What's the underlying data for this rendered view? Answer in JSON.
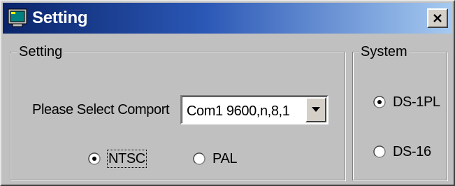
{
  "window": {
    "title": "Setting",
    "icon": "monitor-icon",
    "close_icon": "close-icon"
  },
  "setting_group": {
    "legend": "Setting",
    "comport_label": "Please Select Comport",
    "comport_value": "Com1 9600,n,8,1",
    "dropdown_icon": "chevron-down-icon",
    "video_options": [
      {
        "label": "NTSC",
        "selected": true
      },
      {
        "label": "PAL",
        "selected": false
      }
    ]
  },
  "system_group": {
    "legend": "System",
    "options": [
      {
        "label": "DS-1PL",
        "selected": true
      },
      {
        "label": "DS-16",
        "selected": false
      }
    ]
  },
  "colors": {
    "titlebar_start": "#0a246a",
    "titlebar_end": "#a6caf0",
    "face": "#c0c0c0"
  }
}
